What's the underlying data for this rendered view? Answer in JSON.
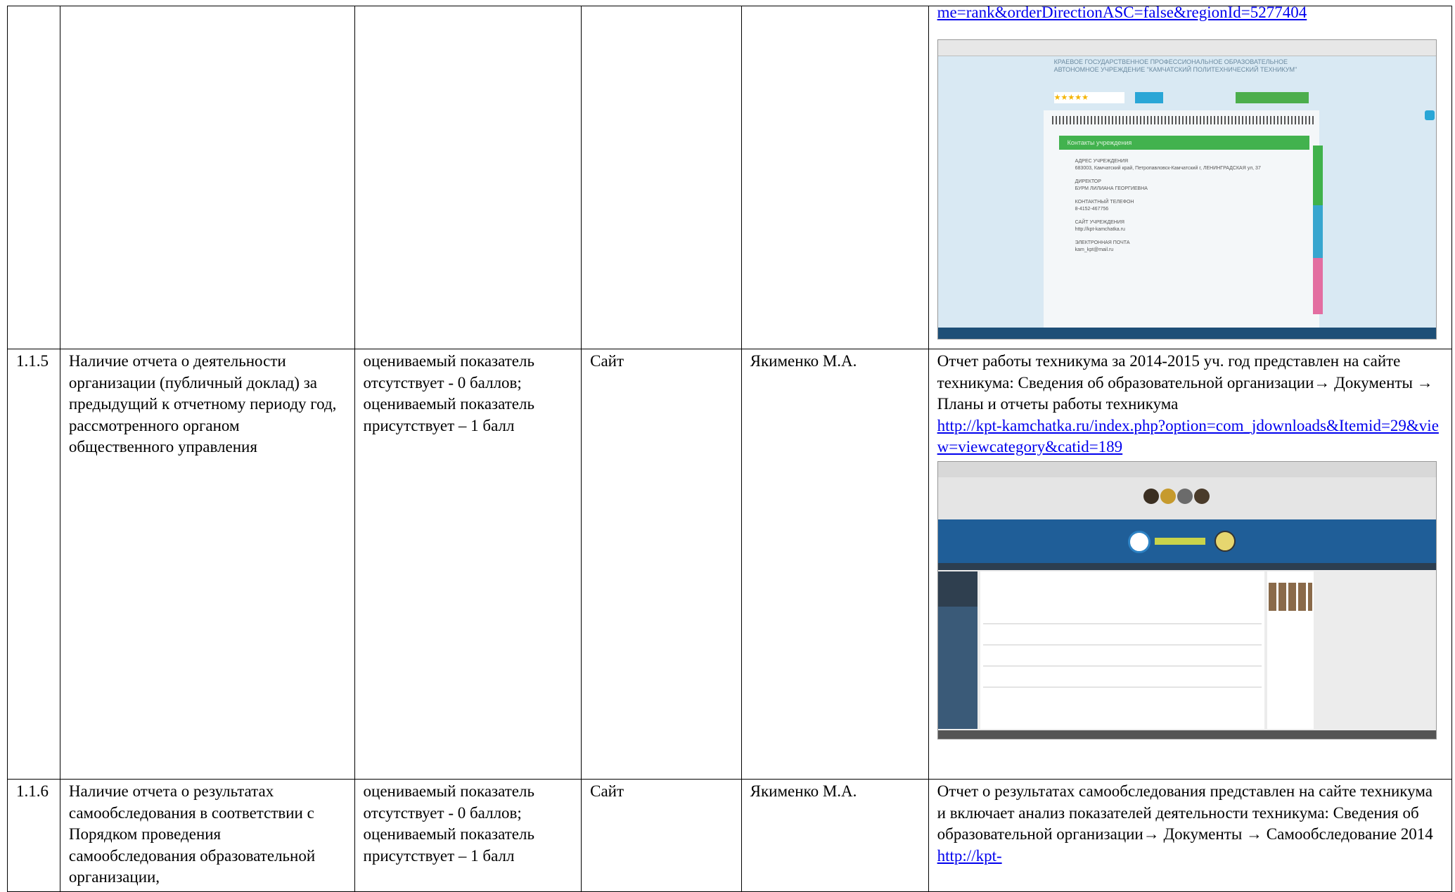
{
  "top_row": {
    "link_text": "me=rank&orderDirectionASC=false&regionId=5277404",
    "screenshot": {
      "header_text": "КРАЕВОЕ ГОСУДАРСТВЕННОЕ ПРОФЕССИОНАЛЬНОЕ ОБРАЗОВАТЕЛЬНОЕ АВТОНОМНОЕ УЧРЕЖДЕНИЕ \"КАМЧАТСКИЙ ПОЛИТЕХНИЧЕСКИЙ ТЕХНИКУМ\"",
      "card_title": "Контакты учреждения",
      "info_lines": [
        "АДРЕС УЧРЕЖДЕНИЯ",
        "683003, Камчатский край, Петропавловск-Камчатский г, ЛЕНИНГРАДСКАЯ ул, 37",
        "ДИРЕКТОР",
        "БУРМ ЛИЛИАНА ГЕОРГИЕВНА",
        "КОНТАКТНЫЙ ТЕЛЕФОН",
        "8-4152-467756",
        "САЙТ УЧРЕЖДЕНИЯ",
        "http://kpt-kamchatka.ru",
        "ЭЛЕКТРОННАЯ ПОЧТА",
        "kam_kpt@mail.ru"
      ]
    }
  },
  "rows": [
    {
      "num": "1.1.5",
      "indicator": "Наличие отчета о деятельности организации (публичный доклад) за предыдущий к отчетному периоду год, рассмотренного органом общественного управления",
      "scale": "оцениваемый показатель отсутствует - 0 баллов;\n оцениваемый показатель присутствует – 1 балл",
      "source": "Сайт",
      "responsible": "Якименко М.А.",
      "evidence": "Отчет работы техникума за 2014-2015 уч. год представлен на сайте техникума: Сведения об образовательной организации→ Документы → Планы и отчеты работы техникума",
      "link": "http://kpt-kamchatka.ru/index.php?option=com_jdownloads&Itemid=29&view=viewcategory&catid=189"
    },
    {
      "num": "1.1.6",
      "indicator": "Наличие отчета о результатах самообследования в соответствии с Порядком проведения самообследования образовательной организации,",
      "scale": "оцениваемый показатель отсутствует - 0 баллов;\n оцениваемый показатель присутствует – 1 балл",
      "source": "Сайт",
      "responsible": "Якименко М.А.",
      "evidence": "Отчет о результатах самообследования представлен на сайте техникума и включает  анализ показателей деятельности техникума: Сведения об образовательной организации→ Документы → Самообследование 2014",
      "link": "http://kpt-"
    }
  ],
  "colors": {
    "link": "#0000ee",
    "border": "#000000"
  }
}
